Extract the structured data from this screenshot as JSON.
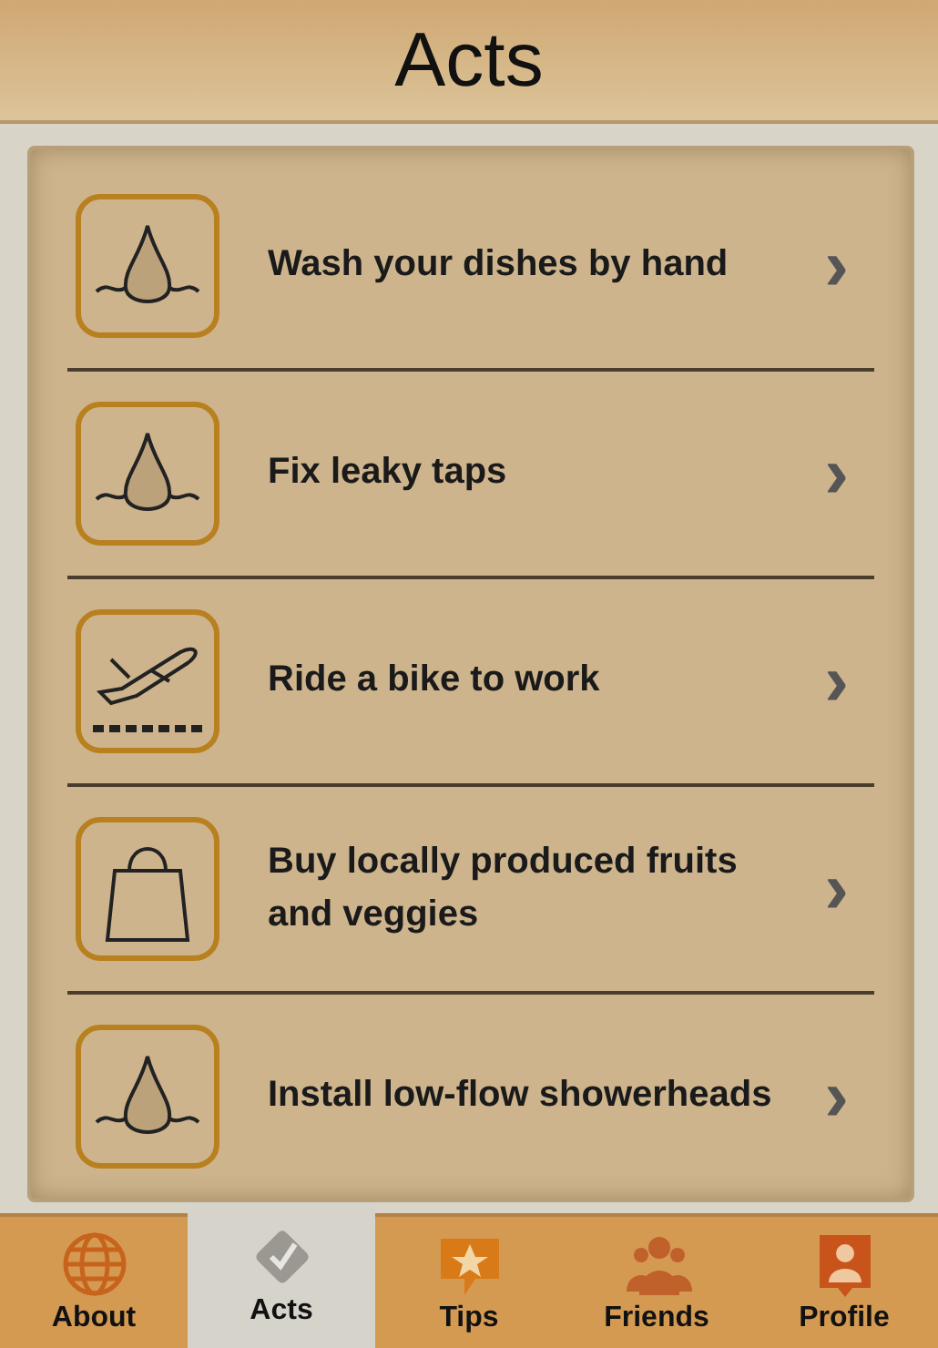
{
  "title": "Acts",
  "acts": [
    {
      "kind": "drop",
      "label": "Wash your dishes by hand",
      "chevron": "›"
    },
    {
      "kind": "drop",
      "label": "Fix leaky taps",
      "chevron": "›"
    },
    {
      "kind": "plane",
      "label": "Ride a bike to work",
      "chevron": "›"
    },
    {
      "kind": "bag",
      "label": "Buy locally produced fruits and veggies",
      "chevron": "›"
    },
    {
      "kind": "drop",
      "label": "Install low-flow showerheads",
      "chevron": "›"
    }
  ],
  "tabs": [
    {
      "kind": "globe",
      "label": "About",
      "selected": false
    },
    {
      "kind": "check",
      "label": "Acts",
      "selected": true
    },
    {
      "kind": "star",
      "label": "Tips",
      "selected": false
    },
    {
      "kind": "people",
      "label": "Friends",
      "selected": false
    },
    {
      "kind": "person",
      "label": "Profile",
      "selected": false
    }
  ]
}
